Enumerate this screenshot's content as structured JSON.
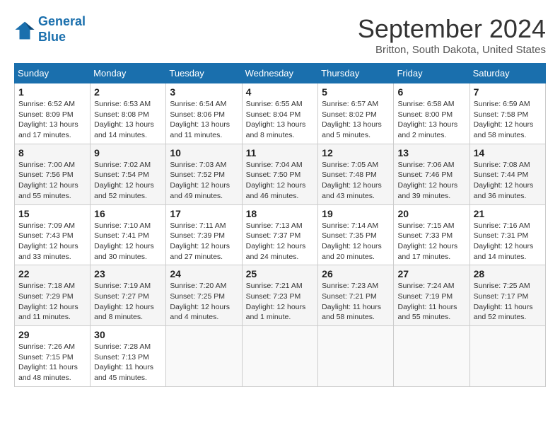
{
  "header": {
    "logo_line1": "General",
    "logo_line2": "Blue",
    "month_title": "September 2024",
    "location": "Britton, South Dakota, United States"
  },
  "weekdays": [
    "Sunday",
    "Monday",
    "Tuesday",
    "Wednesday",
    "Thursday",
    "Friday",
    "Saturday"
  ],
  "weeks": [
    [
      {
        "day": "1",
        "info": "Sunrise: 6:52 AM\nSunset: 8:09 PM\nDaylight: 13 hours and 17 minutes."
      },
      {
        "day": "2",
        "info": "Sunrise: 6:53 AM\nSunset: 8:08 PM\nDaylight: 13 hours and 14 minutes."
      },
      {
        "day": "3",
        "info": "Sunrise: 6:54 AM\nSunset: 8:06 PM\nDaylight: 13 hours and 11 minutes."
      },
      {
        "day": "4",
        "info": "Sunrise: 6:55 AM\nSunset: 8:04 PM\nDaylight: 13 hours and 8 minutes."
      },
      {
        "day": "5",
        "info": "Sunrise: 6:57 AM\nSunset: 8:02 PM\nDaylight: 13 hours and 5 minutes."
      },
      {
        "day": "6",
        "info": "Sunrise: 6:58 AM\nSunset: 8:00 PM\nDaylight: 13 hours and 2 minutes."
      },
      {
        "day": "7",
        "info": "Sunrise: 6:59 AM\nSunset: 7:58 PM\nDaylight: 12 hours and 58 minutes."
      }
    ],
    [
      {
        "day": "8",
        "info": "Sunrise: 7:00 AM\nSunset: 7:56 PM\nDaylight: 12 hours and 55 minutes."
      },
      {
        "day": "9",
        "info": "Sunrise: 7:02 AM\nSunset: 7:54 PM\nDaylight: 12 hours and 52 minutes."
      },
      {
        "day": "10",
        "info": "Sunrise: 7:03 AM\nSunset: 7:52 PM\nDaylight: 12 hours and 49 minutes."
      },
      {
        "day": "11",
        "info": "Sunrise: 7:04 AM\nSunset: 7:50 PM\nDaylight: 12 hours and 46 minutes."
      },
      {
        "day": "12",
        "info": "Sunrise: 7:05 AM\nSunset: 7:48 PM\nDaylight: 12 hours and 43 minutes."
      },
      {
        "day": "13",
        "info": "Sunrise: 7:06 AM\nSunset: 7:46 PM\nDaylight: 12 hours and 39 minutes."
      },
      {
        "day": "14",
        "info": "Sunrise: 7:08 AM\nSunset: 7:44 PM\nDaylight: 12 hours and 36 minutes."
      }
    ],
    [
      {
        "day": "15",
        "info": "Sunrise: 7:09 AM\nSunset: 7:43 PM\nDaylight: 12 hours and 33 minutes."
      },
      {
        "day": "16",
        "info": "Sunrise: 7:10 AM\nSunset: 7:41 PM\nDaylight: 12 hours and 30 minutes."
      },
      {
        "day": "17",
        "info": "Sunrise: 7:11 AM\nSunset: 7:39 PM\nDaylight: 12 hours and 27 minutes."
      },
      {
        "day": "18",
        "info": "Sunrise: 7:13 AM\nSunset: 7:37 PM\nDaylight: 12 hours and 24 minutes."
      },
      {
        "day": "19",
        "info": "Sunrise: 7:14 AM\nSunset: 7:35 PM\nDaylight: 12 hours and 20 minutes."
      },
      {
        "day": "20",
        "info": "Sunrise: 7:15 AM\nSunset: 7:33 PM\nDaylight: 12 hours and 17 minutes."
      },
      {
        "day": "21",
        "info": "Sunrise: 7:16 AM\nSunset: 7:31 PM\nDaylight: 12 hours and 14 minutes."
      }
    ],
    [
      {
        "day": "22",
        "info": "Sunrise: 7:18 AM\nSunset: 7:29 PM\nDaylight: 12 hours and 11 minutes."
      },
      {
        "day": "23",
        "info": "Sunrise: 7:19 AM\nSunset: 7:27 PM\nDaylight: 12 hours and 8 minutes."
      },
      {
        "day": "24",
        "info": "Sunrise: 7:20 AM\nSunset: 7:25 PM\nDaylight: 12 hours and 4 minutes."
      },
      {
        "day": "25",
        "info": "Sunrise: 7:21 AM\nSunset: 7:23 PM\nDaylight: 12 hours and 1 minute."
      },
      {
        "day": "26",
        "info": "Sunrise: 7:23 AM\nSunset: 7:21 PM\nDaylight: 11 hours and 58 minutes."
      },
      {
        "day": "27",
        "info": "Sunrise: 7:24 AM\nSunset: 7:19 PM\nDaylight: 11 hours and 55 minutes."
      },
      {
        "day": "28",
        "info": "Sunrise: 7:25 AM\nSunset: 7:17 PM\nDaylight: 11 hours and 52 minutes."
      }
    ],
    [
      {
        "day": "29",
        "info": "Sunrise: 7:26 AM\nSunset: 7:15 PM\nDaylight: 11 hours and 48 minutes."
      },
      {
        "day": "30",
        "info": "Sunrise: 7:28 AM\nSunset: 7:13 PM\nDaylight: 11 hours and 45 minutes."
      },
      {
        "day": "",
        "info": ""
      },
      {
        "day": "",
        "info": ""
      },
      {
        "day": "",
        "info": ""
      },
      {
        "day": "",
        "info": ""
      },
      {
        "day": "",
        "info": ""
      }
    ]
  ]
}
